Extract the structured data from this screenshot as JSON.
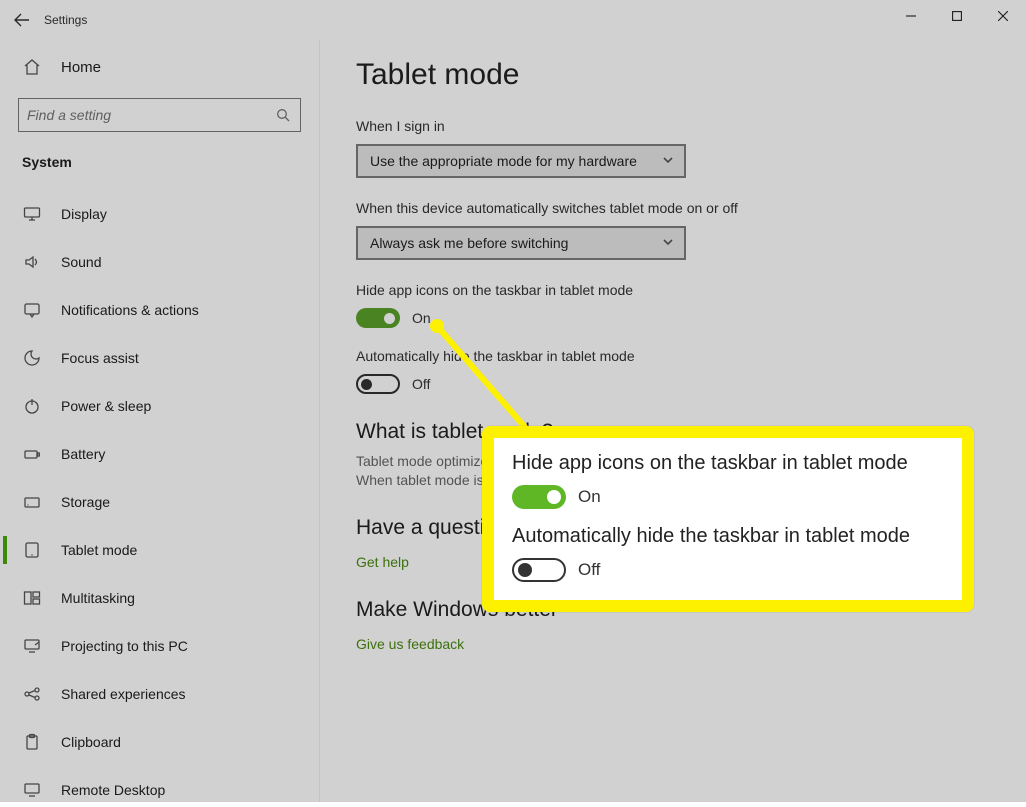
{
  "titlebar": {
    "title": "Settings"
  },
  "sidebar": {
    "home": "Home",
    "search_placeholder": "Find a setting",
    "section": "System",
    "items": [
      {
        "key": "display",
        "label": "Display"
      },
      {
        "key": "sound",
        "label": "Sound"
      },
      {
        "key": "notifications",
        "label": "Notifications & actions"
      },
      {
        "key": "focus-assist",
        "label": "Focus assist"
      },
      {
        "key": "power-sleep",
        "label": "Power & sleep"
      },
      {
        "key": "battery",
        "label": "Battery"
      },
      {
        "key": "storage",
        "label": "Storage"
      },
      {
        "key": "tablet-mode",
        "label": "Tablet mode",
        "active": true
      },
      {
        "key": "multitasking",
        "label": "Multitasking"
      },
      {
        "key": "projecting",
        "label": "Projecting to this PC"
      },
      {
        "key": "shared-experiences",
        "label": "Shared experiences"
      },
      {
        "key": "clipboard",
        "label": "Clipboard"
      },
      {
        "key": "remote-desktop",
        "label": "Remote Desktop"
      }
    ]
  },
  "content": {
    "page_title": "Tablet mode",
    "signin_label": "When I sign in",
    "signin_value": "Use the appropriate mode for my hardware",
    "switch_label": "When this device automatically switches tablet mode on or off",
    "switch_value": "Always ask me before switching",
    "hide_icons_label": "Hide app icons on the taskbar in tablet mode",
    "hide_icons_state": "On",
    "auto_hide_label": "Automatically hide the taskbar in tablet mode",
    "auto_hide_state": "Off",
    "what_title": "What is tablet mode?",
    "what_desc_1": "Tablet mode optimizes your device for touch, so you can use your device without a keyboard.",
    "what_desc_2": "When tablet mode is on, apps open full-screen and desktop icons are reduced.",
    "question_title": "Have a question?",
    "get_help": "Get help",
    "better_title": "Make Windows better",
    "feedback": "Give us feedback"
  },
  "callout": {
    "hide_icons_label": "Hide app icons on the taskbar in tablet mode",
    "hide_icons_state": "On",
    "auto_hide_label": "Automatically hide the taskbar in tablet mode",
    "auto_hide_state": "Off"
  },
  "colors": {
    "accent": "#5aa02a",
    "highlight": "#fdf100",
    "link": "#4a8a0f"
  }
}
